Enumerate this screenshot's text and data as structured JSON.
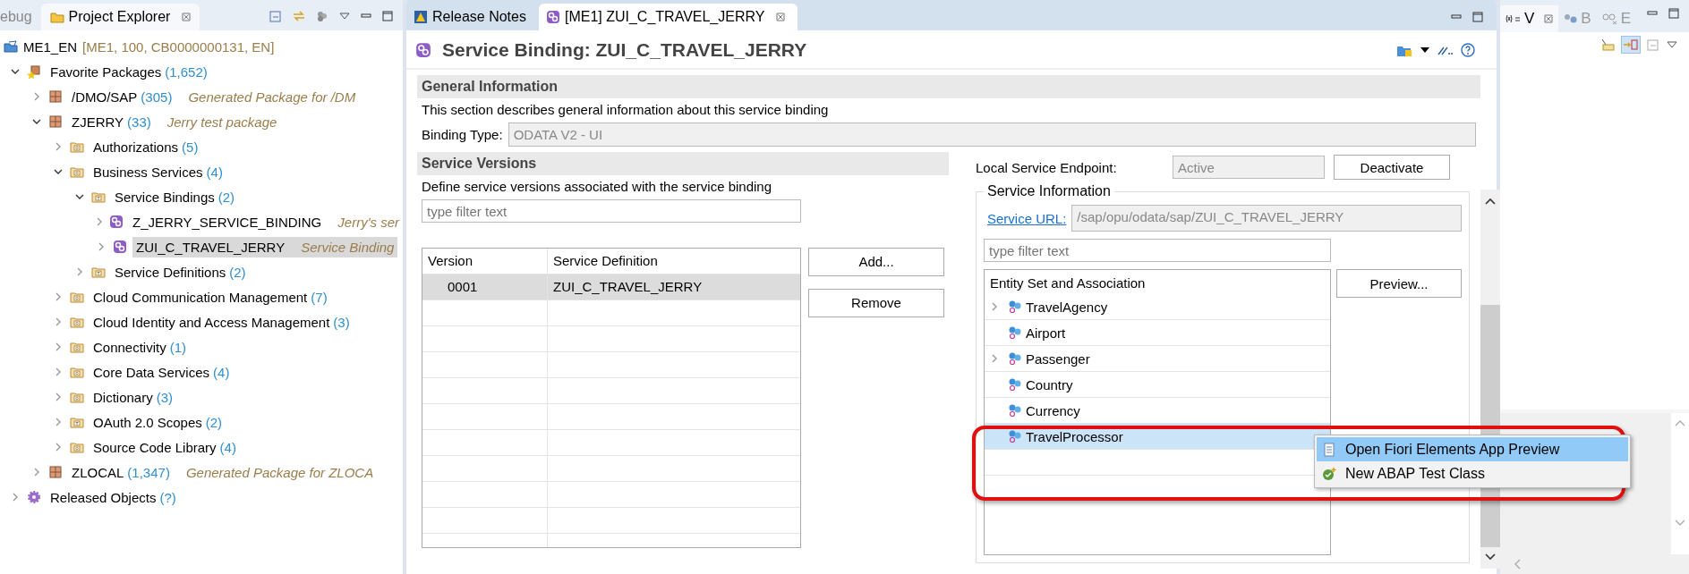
{
  "explorer": {
    "tabs": [
      {
        "label": "ebug",
        "selected": false
      },
      {
        "label": "Project Explorer",
        "selected": true
      }
    ],
    "project": {
      "label": "ME1_EN",
      "info": "[ME1, 100, CB0000000131, EN]"
    },
    "tree": [
      {
        "label": "Favorite Packages",
        "count": "(1,652)",
        "kind": "favorites",
        "expanded": true,
        "selected": false,
        "children": [
          {
            "label": "/DMO/SAP",
            "count": "(305)",
            "description": "Generated Package for /DM",
            "kind": "package",
            "expanded": false,
            "selected": false
          },
          {
            "label": "ZJERRY",
            "count": "(33)",
            "description": "Jerry test package",
            "kind": "package",
            "expanded": true,
            "selected": false,
            "children": [
              {
                "label": "Authorizations",
                "count": "(5)",
                "kind": "group",
                "expanded": false,
                "selected": false
              },
              {
                "label": "Business Services",
                "count": "(4)",
                "kind": "group",
                "expanded": true,
                "selected": false,
                "children": [
                  {
                    "label": "Service Bindings",
                    "count": "(2)",
                    "kind": "type",
                    "expanded": true,
                    "selected": false,
                    "children": [
                      {
                        "label": "Z_JERRY_SERVICE_BINDING",
                        "description": "Jerry's ser",
                        "kind": "binding",
                        "expanded": false,
                        "selected": false
                      },
                      {
                        "label": "ZUI_C_TRAVEL_JERRY",
                        "description": "Service Binding",
                        "kind": "binding",
                        "expanded": false,
                        "selected": true
                      }
                    ]
                  },
                  {
                    "label": "Service Definitions",
                    "count": "(2)",
                    "kind": "type",
                    "expanded": false,
                    "selected": false
                  }
                ]
              },
              {
                "label": "Cloud Communication Management",
                "count": "(7)",
                "kind": "group",
                "expanded": false,
                "selected": false
              },
              {
                "label": "Cloud Identity and Access Management",
                "count": "(3)",
                "kind": "group",
                "expanded": false,
                "selected": false
              },
              {
                "label": "Connectivity",
                "count": "(1)",
                "kind": "group",
                "expanded": false,
                "selected": false
              },
              {
                "label": "Core Data Services",
                "count": "(4)",
                "kind": "group",
                "expanded": false,
                "selected": false
              },
              {
                "label": "Dictionary",
                "count": "(3)",
                "kind": "group",
                "expanded": false,
                "selected": false
              },
              {
                "label": "OAuth 2.0 Scopes",
                "count": "(2)",
                "kind": "type",
                "expanded": false,
                "selected": false
              },
              {
                "label": "Source Code Library",
                "count": "(4)",
                "kind": "group",
                "expanded": false,
                "selected": false
              }
            ]
          },
          {
            "label": "ZLOCAL",
            "count": "(1,347)",
            "description": "Generated Package for ZLOCA",
            "kind": "package",
            "expanded": false,
            "selected": false
          }
        ]
      },
      {
        "label": "Released Objects",
        "count": "(?)",
        "kind": "gear",
        "expanded": false,
        "selected": false
      }
    ]
  },
  "editor": {
    "tabs": [
      {
        "label": "Release Notes",
        "kind": "notes",
        "selected": false
      },
      {
        "label": "[ME1] ZUI_C_TRAVEL_JERRY",
        "kind": "binding",
        "selected": true
      }
    ],
    "title": "Service Binding: ZUI_C_TRAVEL_JERRY",
    "general": {
      "heading": "General Information",
      "description": "This section describes general information about this service binding",
      "binding_type_label": "Binding Type:",
      "binding_type": "ODATA V2 - UI"
    },
    "versions": {
      "heading": "Service Versions",
      "description": "Define service versions associated with the service binding",
      "filter_placeholder": "type filter text",
      "columns": [
        "Version",
        "Service Definition"
      ],
      "rows": [
        {
          "version": "0001",
          "definition": "ZUI_C_TRAVEL_JERRY",
          "selected": true
        }
      ],
      "buttons": [
        "Add...",
        "Remove"
      ]
    },
    "endpoint": {
      "label": "Local Service Endpoint:",
      "status": "Active",
      "button": "Deactivate"
    },
    "service_info": {
      "heading": "Service Information",
      "url_label": "Service URL:",
      "url": "/sap/opu/odata/sap/ZUI_C_TRAVEL_JERRY",
      "filter_placeholder": "type filter text",
      "tree_heading": "Entity Set and Association",
      "button": "Preview...",
      "entities": [
        {
          "label": "TravelAgency",
          "expandable": true,
          "selected": false
        },
        {
          "label": "Airport",
          "expandable": false,
          "selected": false
        },
        {
          "label": "Passenger",
          "expandable": true,
          "selected": false
        },
        {
          "label": "Country",
          "expandable": false,
          "selected": false
        },
        {
          "label": "Currency",
          "expandable": false,
          "selected": false
        },
        {
          "label": "TravelProcessor",
          "expandable": false,
          "selected": true
        }
      ]
    },
    "context_menu": [
      {
        "label": "Open Fiori Elements App Preview",
        "kind": "preview",
        "selected": true
      },
      {
        "label": "New ABAP Test Class",
        "kind": "test",
        "selected": false
      }
    ]
  },
  "side_panel": {
    "tabs": [
      {
        "label": "V",
        "kind": "variables",
        "selected": true
      },
      {
        "label": "B",
        "kind": "breakpoints",
        "selected": false
      },
      {
        "label": "E",
        "kind": "expressions",
        "selected": false
      }
    ]
  }
}
